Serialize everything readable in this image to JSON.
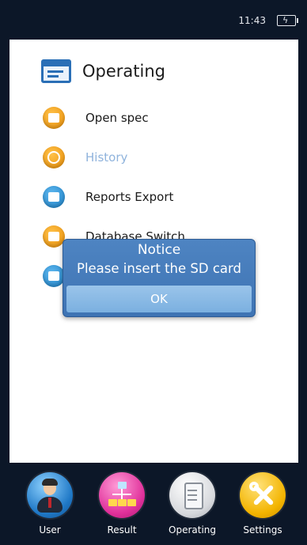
{
  "status_bar": {
    "time": "11:43",
    "battery_icon": "battery-charging-icon"
  },
  "header": {
    "icon": "operating-list-icon",
    "title": "Operating"
  },
  "menu": {
    "items": [
      {
        "label": "Open spec",
        "icon": "folder-open-icon",
        "color": "#f0a11a",
        "state": "normal"
      },
      {
        "label": "History",
        "icon": "history-icon",
        "color": "#f0a11a",
        "state": "disabled"
      },
      {
        "label": "Reports Export",
        "icon": "export-icon",
        "color": "#2b8fd6",
        "state": "normal"
      },
      {
        "label": "Database Switch",
        "icon": "database-icon",
        "color": "#f0a11a",
        "state": "normal"
      },
      {
        "label": "",
        "icon": "print-icon",
        "color": "#2b8fd6",
        "state": "obscured"
      }
    ]
  },
  "dialog": {
    "title": "Notice",
    "message": "Please insert the SD card",
    "button_label": "OK"
  },
  "bottom_nav": {
    "items": [
      {
        "label": "User",
        "icon": "user-icon",
        "color": "#1f78c6"
      },
      {
        "label": "Result",
        "icon": "result-chart-icon",
        "color": "#e0309a"
      },
      {
        "label": "Operating",
        "icon": "operating-icon",
        "color": "#d7d9dd"
      },
      {
        "label": "Settings",
        "icon": "settings-tools-icon",
        "color": "#f3b400"
      }
    ]
  },
  "colors": {
    "background": "#0c1728",
    "panel": "#ffffff",
    "accent": "#2a6fb6",
    "dialog": "#4679bb",
    "dialog_button": "#8abbe6"
  }
}
